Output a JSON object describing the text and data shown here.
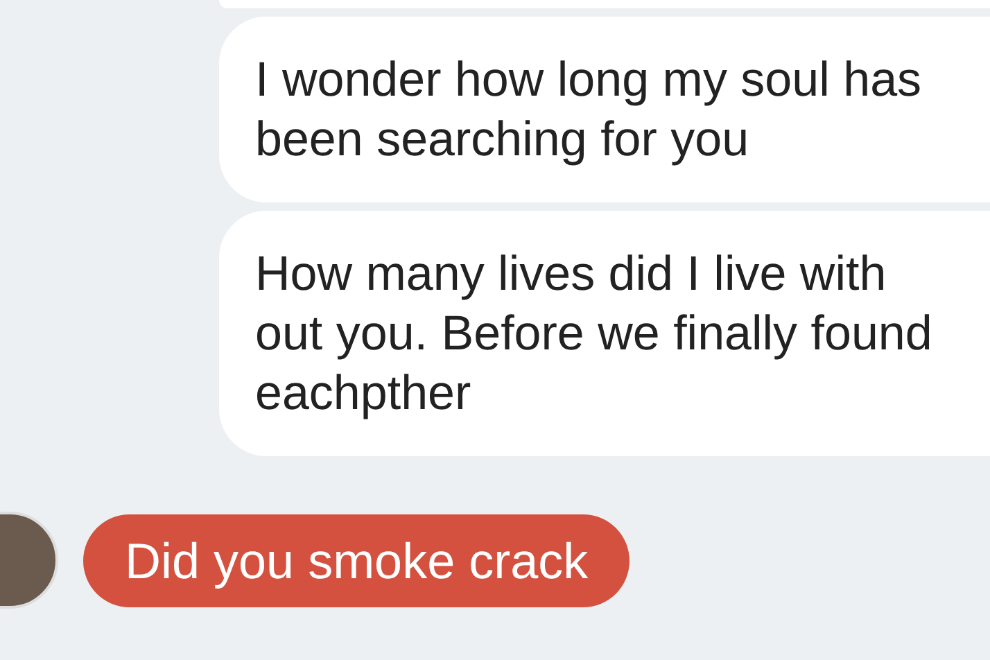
{
  "messages": [
    {
      "kind": "sent"
    },
    {
      "kind": "sent",
      "text": "I wonder how long my soul has\nbeen searching for you"
    },
    {
      "kind": "sent",
      "text": "How many lives did I live with\nout you. Before we finally found\neachpther"
    },
    {
      "kind": "received",
      "text": "Did you smoke crack"
    }
  ]
}
